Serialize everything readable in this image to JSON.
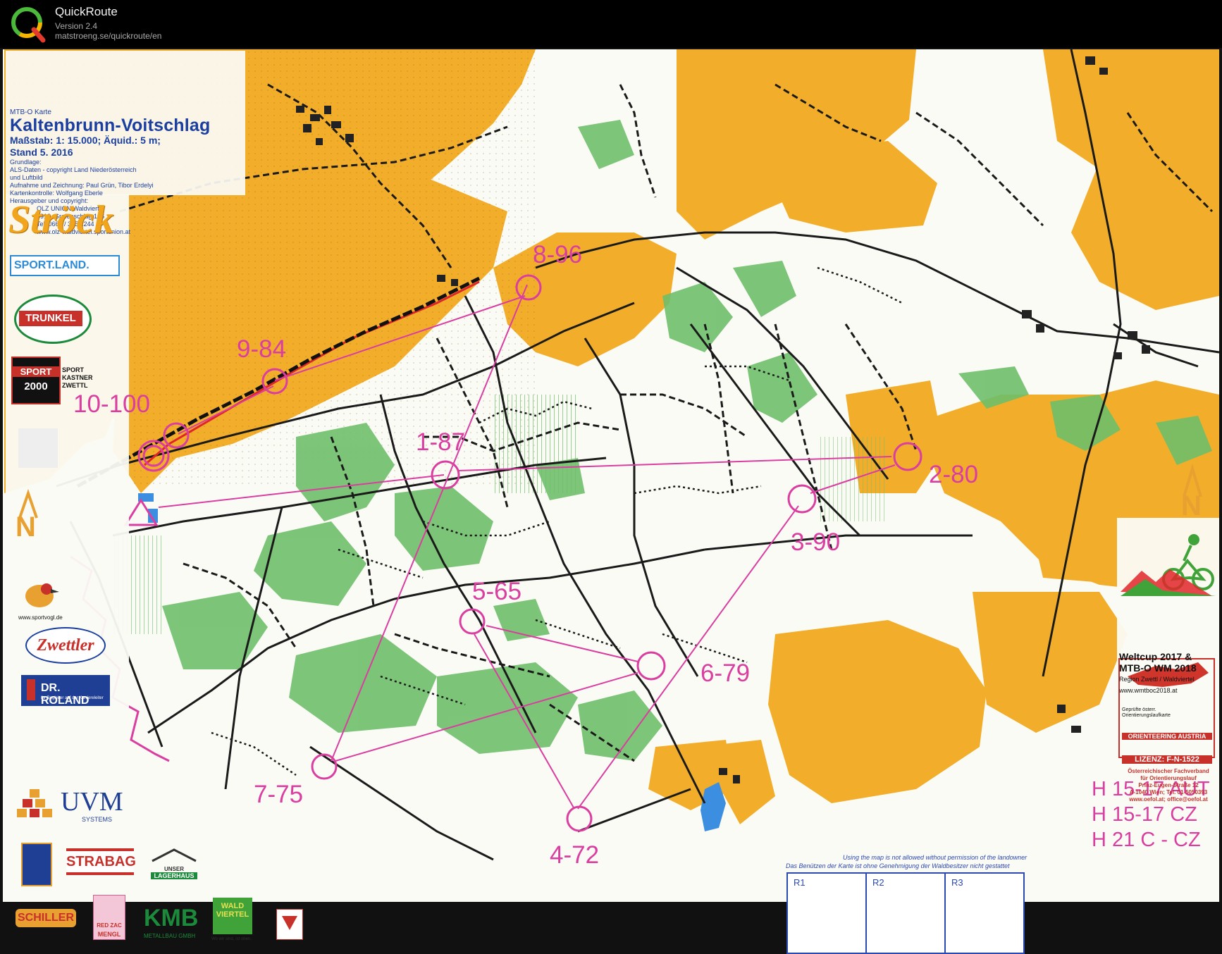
{
  "app": {
    "title": "QuickRoute",
    "version": "Version 2.4",
    "url": "matstroeng.se/quickroute/en"
  },
  "legend": {
    "kind": "MTB-O Karte",
    "title": "Kaltenbrunn-Voitschlag",
    "scale": "Maßstab: 1: 15.000; Äquid.: 5 m;",
    "stand": "Stand 5. 2016",
    "lines": [
      "Grundlage:",
      "ALS-Daten - copyright Land Niederösterreich",
      "und Luftbild",
      "Aufnahme und Zeichnung: Paul Grün, Tibor Erdelyi",
      "Kartenkontrolle: Wolfgang Eberle",
      "Herausgeber und copyright:",
      "OLZ UNION Waldviertel",
      "3912, Grafenschlag 106",
      "Tel. 0664 / 395 2244",
      "www.olz-waldviertel.sportunion.at"
    ]
  },
  "controls": [
    {
      "label": "1-87"
    },
    {
      "label": "2-80"
    },
    {
      "label": "3-90"
    },
    {
      "label": "4-72"
    },
    {
      "label": "5-65"
    },
    {
      "label": "6-79"
    },
    {
      "label": "7-75"
    },
    {
      "label": "8-96"
    },
    {
      "label": "9-84"
    },
    {
      "label": "10-100"
    }
  ],
  "classes": [
    "H 15-17  AUT",
    "H 15-17  CZ",
    "H 21 C  -  CZ"
  ],
  "sponsors": {
    "stroeck": "Ströck",
    "sportland": "SPORT.LAND.",
    "trunkel": "TRUNKEL",
    "sport2000_a": "SPORT",
    "sport2000_b": "2000",
    "kastner_a": "SPORT",
    "kastner_b": "KASTNER",
    "kastner_c": "ZWETTL",
    "sportvogl": "www.sportvogl.de",
    "zwettler": "Zwettler",
    "roland": "DR. ROLAND",
    "roland_sub": "Ihr Begleiter auf der Karriereleiter",
    "uvm": "UVM",
    "uvm_sub": "SYSTEMS",
    "strabag": "STRABAG",
    "lagerhaus_a": "UNSER",
    "lagerhaus_b": "LAGERHAUS",
    "schiller": "SCHILLER",
    "redzac": "RED ZAC",
    "mengl": "MENGL",
    "kmb": "KMB",
    "kmb_sub": "METALLBAU GMBH",
    "waldviertel": "WALD VIERTEL",
    "waldviertel_sub": "Wo wir sind, ist oben."
  },
  "event": {
    "line1": "Weltcup 2017 &",
    "line2": "MTB-O WM 2018",
    "line3": "Region Zwettl / Waldviertel",
    "line4": "www.wmtboc2018.at"
  },
  "license": {
    "top": "Geprüfte österr. Orientierungslaufkarte",
    "brand": "ORIENTEERING AUSTRIA",
    "number": "LIZENZ: F-N-1522",
    "lines": [
      "Österreichischer Fachverband",
      "für Orientierungslauf",
      "Prinz-Eugen-Straße 12",
      "A-1040 Wien; Tel. 01-5050393",
      "www.oefol.at; office@oefol.at"
    ]
  },
  "notice": {
    "en": "Using the map is not allowed without permission of the landowner",
    "de": "Das Benützen der Karte ist ohne Genehmigung der Waldbesitzer nicht gestattet"
  },
  "boxes": [
    "R1",
    "R2",
    "R3"
  ],
  "north": "N",
  "colors": {
    "open": "#f2ae2a",
    "forest": "#ffffff",
    "green": "#6fbf6a",
    "course": "#d93ea0",
    "route": "#e0262a",
    "map_text": "#1a3fa0"
  }
}
